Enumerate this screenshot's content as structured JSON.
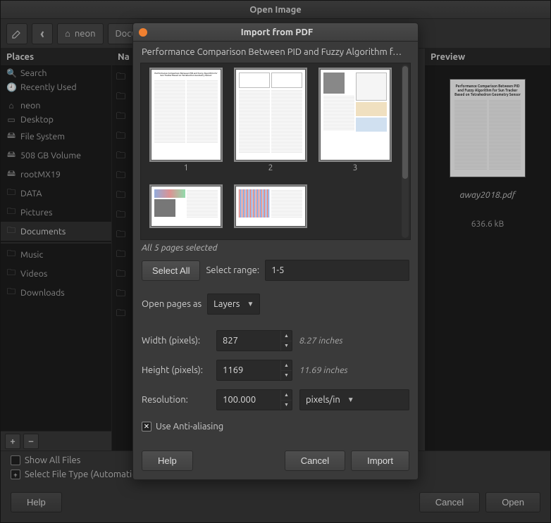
{
  "window": {
    "title": "Open Image"
  },
  "toolbar": {
    "back_glyph": "‹",
    "home_glyph": "⌂",
    "home_label": "neon",
    "crumb_docs": "Docum"
  },
  "places": {
    "header": "Places",
    "items": [
      {
        "icon": "🔍",
        "label": "Search"
      },
      {
        "icon": "🕘",
        "label": "Recently Used"
      },
      {
        "icon": "⌂",
        "label": "neon"
      },
      {
        "icon": "▭",
        "label": "Desktop"
      },
      {
        "icon": "🖴",
        "label": "File System"
      },
      {
        "icon": "🖴",
        "label": "508 GB Volume"
      },
      {
        "icon": "🖴",
        "label": "rootMX19"
      },
      {
        "icon": "🗀",
        "label": "DATA"
      },
      {
        "icon": "🗀",
        "label": "Pictures"
      },
      {
        "icon": "🗀",
        "label": "Documents"
      },
      {
        "icon": "🗀",
        "label": "Music"
      },
      {
        "icon": "🗀",
        "label": "Videos"
      },
      {
        "icon": "🗀",
        "label": "Downloads"
      }
    ],
    "plus": "+",
    "minus": "–"
  },
  "name_header": "Na",
  "folder_glyph": "🗀",
  "preview": {
    "header": "Preview",
    "filename": "away2018.pdf",
    "size": "636.6 kB"
  },
  "options": {
    "show_all": "Show All Files",
    "select_type": "Select File Type (Automatic"
  },
  "footer": {
    "help": "Help",
    "cancel": "Cancel",
    "open": "Open"
  },
  "modal": {
    "title": "Import from PDF",
    "subtitle": "Performance Comparison Between PID and Fuzzy Algorithm f…",
    "pages": [
      "1",
      "2",
      "3"
    ],
    "status": "All 5 pages selected",
    "select_all": "Select All",
    "select_range_label": "Select range:",
    "select_range_value": "1-5",
    "open_as_label": "Open pages as",
    "open_as_value": "Layers",
    "width_label": "Width (pixels):",
    "width_value": "827",
    "width_hint": "8.27 inches",
    "height_label": "Height (pixels):",
    "height_value": "1169",
    "height_hint": "11.69 inches",
    "res_label": "Resolution:",
    "res_value": "100.000",
    "res_unit": "pixels/in",
    "aa_label": "Use Anti-aliasing",
    "help": "Help",
    "cancel": "Cancel",
    "import": "Import"
  }
}
